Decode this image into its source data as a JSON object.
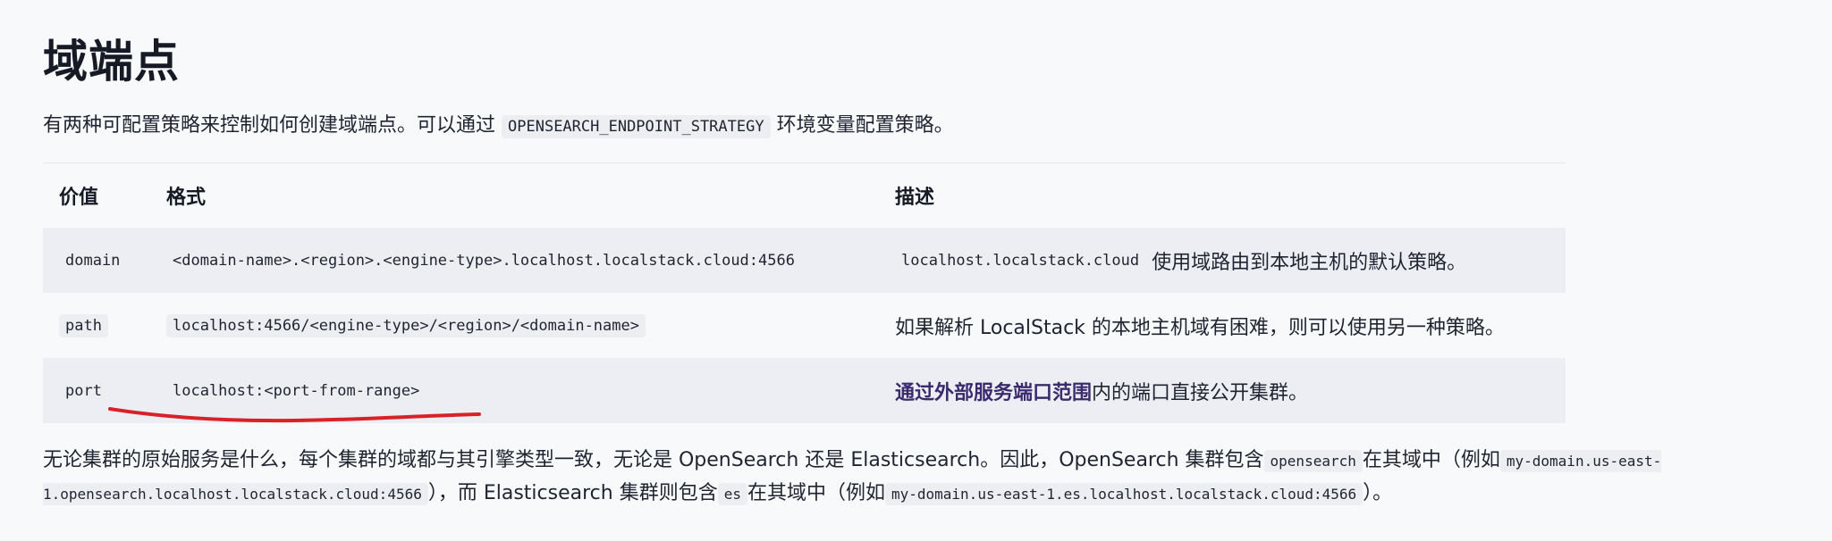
{
  "heading": "域端点",
  "intro": {
    "before": "有两种可配置策略来控制如何创建域端点。可以通过",
    "code": "OPENSEARCH_ENDPOINT_STRATEGY",
    "after": "环境变量配置策略。"
  },
  "table": {
    "headers": [
      "价值",
      "格式",
      "描述"
    ],
    "rows": [
      {
        "value": "domain",
        "format": "<domain-name>.<region>.<engine-type>.localhost.localstack.cloud:4566",
        "desc_code": "localhost.localstack.cloud",
        "desc_text": "使用域路由到本地主机的默认策略。"
      },
      {
        "value": "path",
        "format": "localhost:4566/<engine-type>/<region>/<domain-name>",
        "desc_text": "如果解析 LocalStack 的本地主机域有困难，则可以使用另一种策略。"
      },
      {
        "value": "port",
        "format": "localhost:<port-from-range>",
        "desc_link": "通过外部服务端口范围",
        "desc_text": "内的端口直接公开集群。"
      }
    ]
  },
  "outro": {
    "t1": "无论集群的原始服务是什么，每个集群的域都与其引擎类型一致，无论是 OpenSearch 还是 Elasticsearch。因此，OpenSearch 集群包含",
    "c1": "opensearch",
    "t2": "在其域中（例如",
    "c2": "my-domain.us-east-1.opensearch.localhost.localstack.cloud:4566",
    "t3": "），而 Elasticsearch 集群则包含",
    "c3": "es",
    "t4": "在其域中（例如",
    "c4": "my-domain.us-east-1.es.localhost.localstack.cloud:4566",
    "t5": "）。"
  },
  "annotation_color": "#d8222a"
}
